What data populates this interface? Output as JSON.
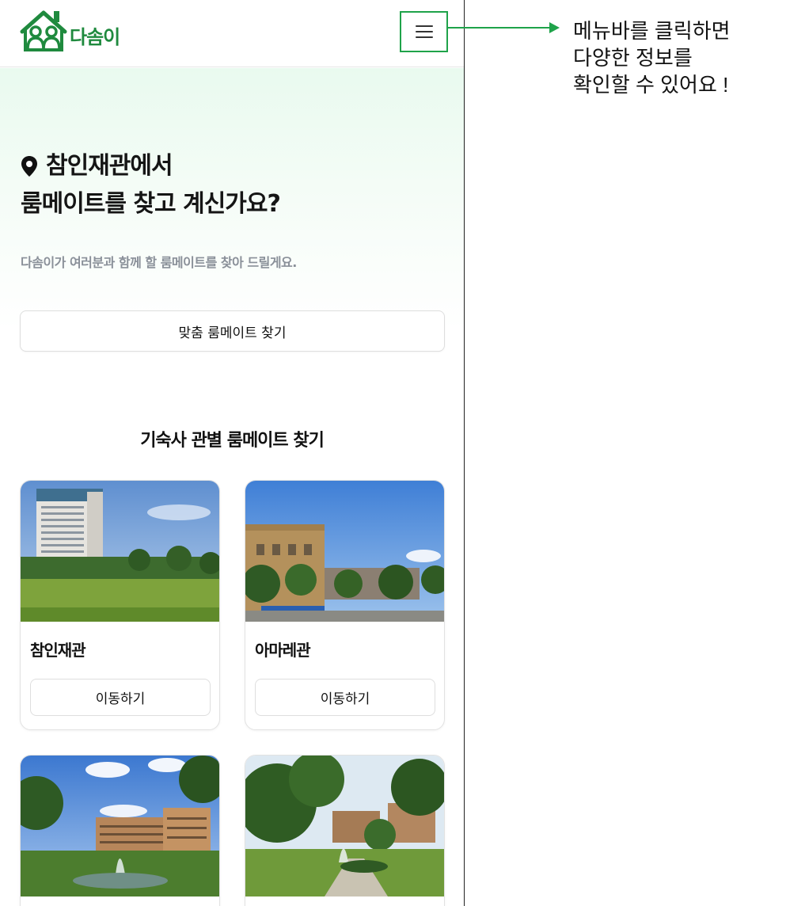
{
  "header": {
    "logo_text": "다솜이",
    "menu_icon": "hamburger-menu-icon"
  },
  "hero": {
    "icon": "location-pin-icon",
    "title_line1": "참인재관에서",
    "title_line2": "룸메이트를 찾고 계신가요?",
    "subtitle": "다솜이가 여러분과 함께 할 룸메이트를 찾아 드릴게요.",
    "cta_label": "맞춤 룸메이트 찾기"
  },
  "section": {
    "title": "기숙사 관별 룸메이트 찾기"
  },
  "dorms": [
    {
      "name": "참인재관",
      "button": "이동하기"
    },
    {
      "name": "아마레관",
      "button": "이동하기"
    },
    {
      "name": "",
      "button": ""
    },
    {
      "name": "",
      "button": ""
    }
  ],
  "annotation": {
    "line1": "메뉴바를 클릭하면",
    "line2": "다양한 정보를",
    "line3": "확인할 수 있어요 !"
  },
  "colors": {
    "brand_green": "#1f8a3e",
    "annotation_green": "#1fa34a",
    "hero_bg": "#e9faef"
  }
}
